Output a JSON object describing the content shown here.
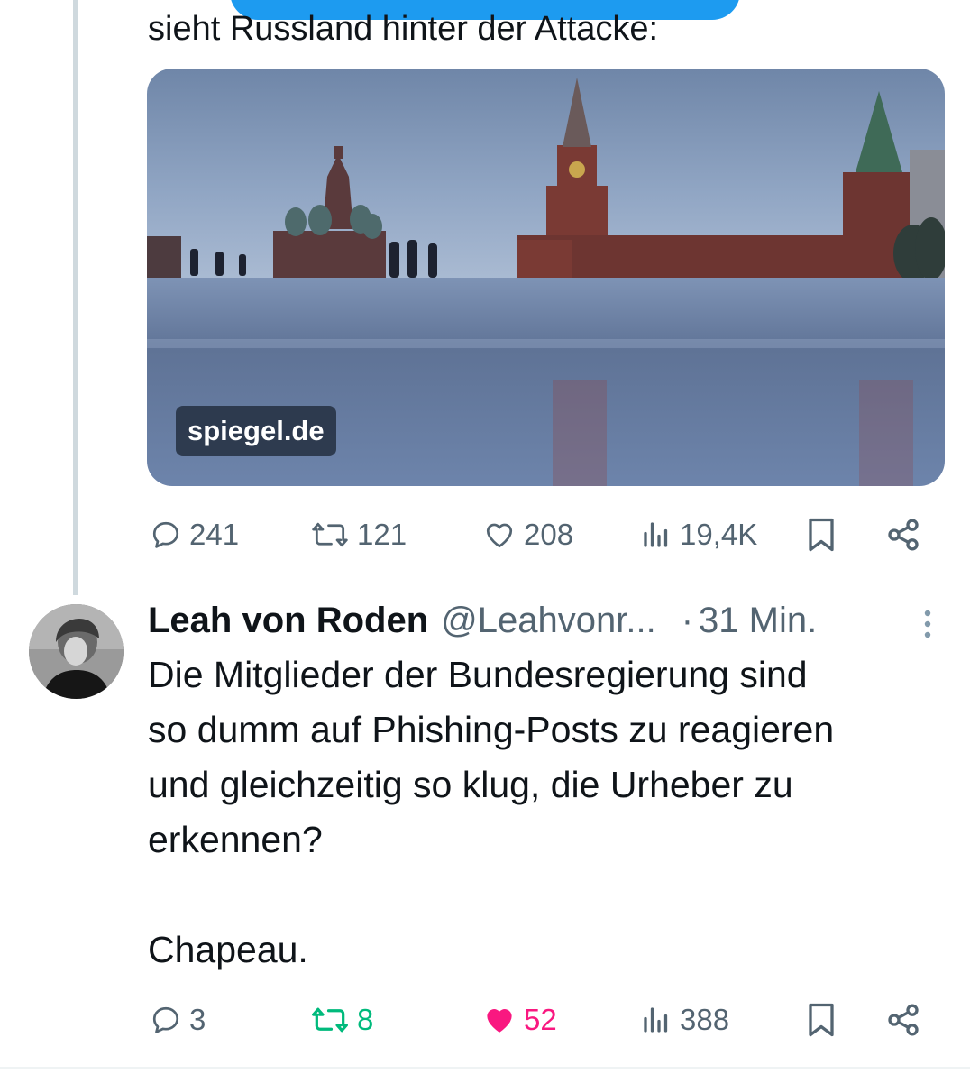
{
  "previous_post": {
    "text_tail": "sieht Russland hinter der Attacke:",
    "link_card": {
      "domain": "spiegel.de"
    },
    "stats": {
      "replies": "241",
      "reposts": "121",
      "likes": "208",
      "views": "19,4K"
    }
  },
  "reply_post": {
    "author_name": "Leah von Roden",
    "author_handle": "@Leahvonr...",
    "separator": "·",
    "time": "31 Min.",
    "text_lines": [
      "Die Mitglieder der Bundesregierung sind",
      "so dumm auf Phishing-Posts zu reagieren",
      "und gleichzeitig so klug, die Urheber zu",
      "erkennen?"
    ],
    "text_closing": "Chapeau.",
    "stats": {
      "replies": "3",
      "reposts": "8",
      "likes": "52",
      "views": "388"
    },
    "state": {
      "reposted": true,
      "liked": true
    }
  },
  "colors": {
    "text_primary": "#0f1419",
    "text_secondary": "#536471",
    "repost_active": "#00ba7c",
    "like_active": "#f91880",
    "thread_line": "#cfd9de",
    "accent": "#1d9bf0"
  },
  "icons": [
    "reply-icon",
    "repost-icon",
    "like-icon",
    "views-icon",
    "bookmark-icon",
    "share-icon",
    "more-icon"
  ]
}
